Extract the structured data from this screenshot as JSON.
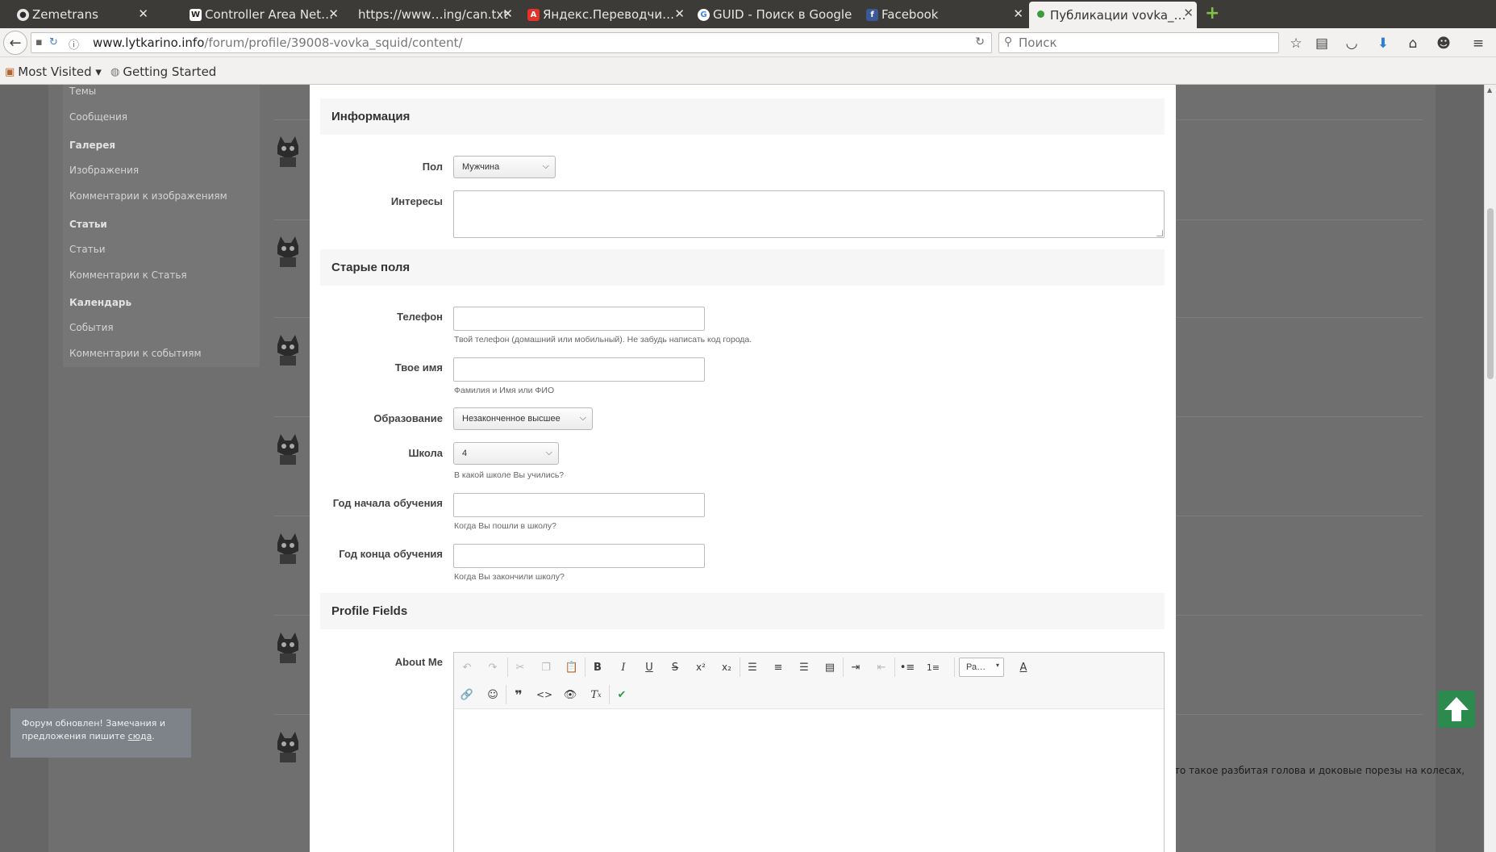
{
  "browser": {
    "tabs": [
      {
        "label": "Zemetrans",
        "icon": "github-icon",
        "color": "#2b2b2b"
      },
      {
        "label": "Controller Area Net…",
        "icon": "wikipedia-icon",
        "color": "#ffffff"
      },
      {
        "label": "https://www…ing/can.txt",
        "icon": "",
        "color": ""
      },
      {
        "label": "Яндекс.Переводчи…",
        "icon": "yandex-icon",
        "color": "#e6332a"
      },
      {
        "label": "GUID - Поиск в Google",
        "icon": "google-icon",
        "color": "#ffffff"
      },
      {
        "label": "Facebook",
        "icon": "facebook-icon",
        "color": "#3b5998"
      },
      {
        "label": "Публикации vovka_…",
        "icon": "green-dot-icon",
        "color": "#3a9d3a",
        "active": true
      }
    ],
    "url_host": "www.lytkarino.info",
    "url_path": "/forum/profile/39008-vovka_squid/content/",
    "search_placeholder": "Поиск",
    "bookmarks": [
      {
        "label": "Most Visited ▾",
        "icon": "folder-icon"
      },
      {
        "label": "Getting Started",
        "icon": "firefox-icon"
      }
    ]
  },
  "sidebar_menu": {
    "items": [
      {
        "label": "Темы",
        "type": "item"
      },
      {
        "label": "Сообщения",
        "type": "item"
      },
      {
        "label": "Галерея",
        "type": "head"
      },
      {
        "label": "Изображения",
        "type": "item"
      },
      {
        "label": "Комментарии к изображениям",
        "type": "item"
      },
      {
        "label": "Статьи",
        "type": "head"
      },
      {
        "label": "Статьи",
        "type": "item"
      },
      {
        "label": "Комментарии к Статья",
        "type": "item"
      },
      {
        "label": "Календарь",
        "type": "head"
      },
      {
        "label": "События",
        "type": "item"
      },
      {
        "label": "Комментарии к событиям",
        "type": "item"
      }
    ]
  },
  "background_snippet": "то такое разбитая голова и доковые порезы на колесах,",
  "notice": {
    "text": "Форум обновлен! Замечания и предложения пишите ",
    "link": "сюда",
    "tail": "."
  },
  "form": {
    "sections": {
      "info": "Информация",
      "old_fields": "Старые поля",
      "profile_fields": "Profile Fields"
    },
    "gender": {
      "label": "Пол",
      "value": "Мужчина"
    },
    "interests": {
      "label": "Интересы",
      "value": ""
    },
    "phone": {
      "label": "Телефон",
      "value": "",
      "hint": "Твой телефон (домашний или мобильный). Не забудь написать код города."
    },
    "name": {
      "label": "Твое имя",
      "value": "",
      "hint": "Фамилия и Имя или ФИО"
    },
    "education": {
      "label": "Образование",
      "value": "Незаконченное высшее"
    },
    "school": {
      "label": "Школа",
      "value": "4",
      "hint": "В какой школе Вы учились?"
    },
    "study_start": {
      "label": "Год начала обучения",
      "value": "",
      "hint": "Когда Вы пошли в школу?"
    },
    "study_end": {
      "label": "Год конца обучения",
      "value": "",
      "hint": "Когда Вы закончили школу?"
    },
    "about": {
      "label": "About Me",
      "format_value": "Ра…",
      "value": ""
    }
  },
  "colors": {
    "overlay": "#6b6b6b",
    "scroll_top_button": "#2d8a4e"
  }
}
